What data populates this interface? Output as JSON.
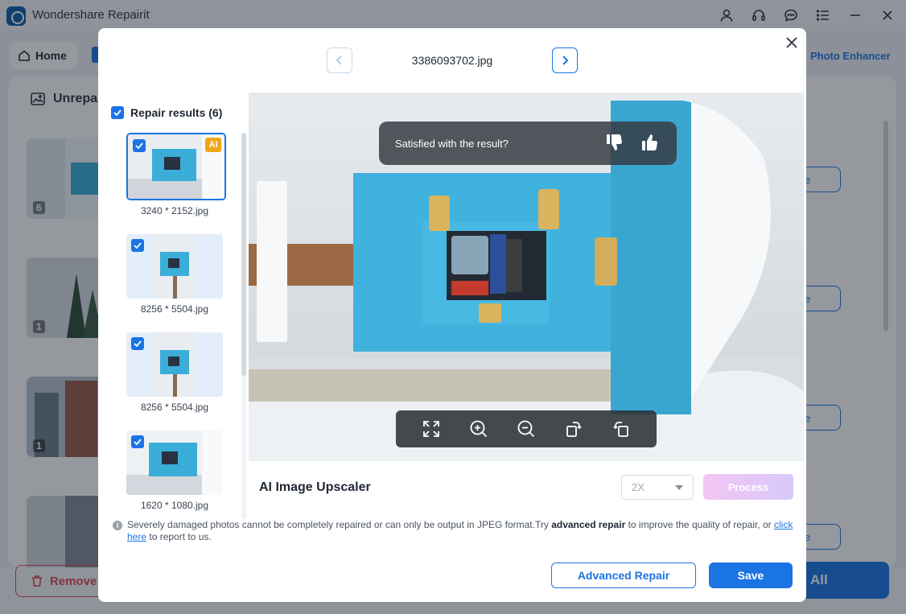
{
  "app": {
    "title": "Wondershare Repairit",
    "home_label": "Home",
    "photo_enhancer_tab": "Photo Enhancer",
    "unrepaired_heading": "Unrepa",
    "background_counts": [
      "6",
      "1",
      "1"
    ],
    "background_row_button": "e",
    "remove_button": "Remove",
    "save_all_button": "All",
    "accent_color": "#1b74e4",
    "remove_color": "#e0454b"
  },
  "modal": {
    "file_name": "3386093702.jpg",
    "results_header": "Repair results (6)",
    "ai_badge": "AI",
    "results": [
      {
        "label": "3240 * 2152.jpg",
        "checked": true,
        "selected": true,
        "ai": true
      },
      {
        "label": "8256 * 5504.jpg",
        "checked": true,
        "selected": false,
        "ai": false
      },
      {
        "label": "8256 * 5504.jpg",
        "checked": true,
        "selected": false,
        "ai": false
      },
      {
        "label": "1620 * 1080.jpg",
        "checked": true,
        "selected": false,
        "ai": false
      }
    ],
    "feedback_prompt": "Satisfied with the result?",
    "upscaler_title": "AI Image Upscaler",
    "scale_value": "2X",
    "process_button": "Process",
    "note": {
      "part1": "Severely damaged photos cannot be completely repaired or can only be output in JPEG format.Try ",
      "bold": "advanced repair",
      "part2": " to improve the quality of repair, or ",
      "link": "click here",
      "part3": " to report to us."
    },
    "advanced_repair_button": "Advanced Repair",
    "save_button": "Save"
  },
  "icons": {
    "title_bar": [
      "user-icon",
      "headset-icon",
      "chat-icon",
      "menu-icon",
      "minimize-icon",
      "close-icon"
    ],
    "viewer_toolbar": [
      "fit-screen-icon",
      "zoom-in-icon",
      "zoom-out-icon",
      "rotate-left-icon",
      "rotate-right-icon"
    ]
  }
}
